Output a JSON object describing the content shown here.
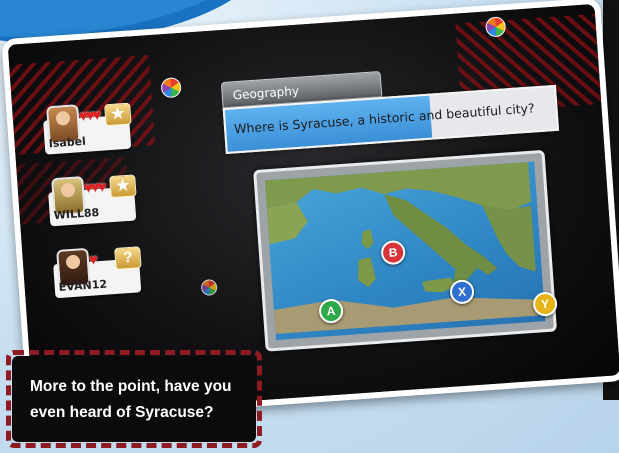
{
  "quiz": {
    "category": "Geography",
    "question": "Where is Syracuse, a historic and beautiful city?",
    "timer_fraction": 0.62,
    "answers": [
      {
        "letter": "A",
        "color": "#2ea84a"
      },
      {
        "letter": "B",
        "color": "#d8323a"
      },
      {
        "letter": "X",
        "color": "#2f6fd0"
      },
      {
        "letter": "Y",
        "color": "#e7b51a"
      }
    ]
  },
  "players": [
    {
      "name": "Isabel",
      "hearts": "♥♥♥",
      "slot_icon": "star-icon",
      "slot_glyph": "★"
    },
    {
      "name": "WILL88",
      "hearts": "♥♥♥",
      "slot_icon": "star-icon",
      "slot_glyph": "★"
    },
    {
      "name": "EVAN12",
      "hearts": "♥",
      "slot_icon": "question-icon",
      "slot_glyph": "?"
    }
  ],
  "caption": {
    "line1": "More to the point, have you",
    "line2": "even heard of Syracuse?"
  },
  "colors": {
    "accent_blue": "#3a8fd6",
    "heart_red": "#e02020",
    "caption_border": "#8e1b22"
  }
}
